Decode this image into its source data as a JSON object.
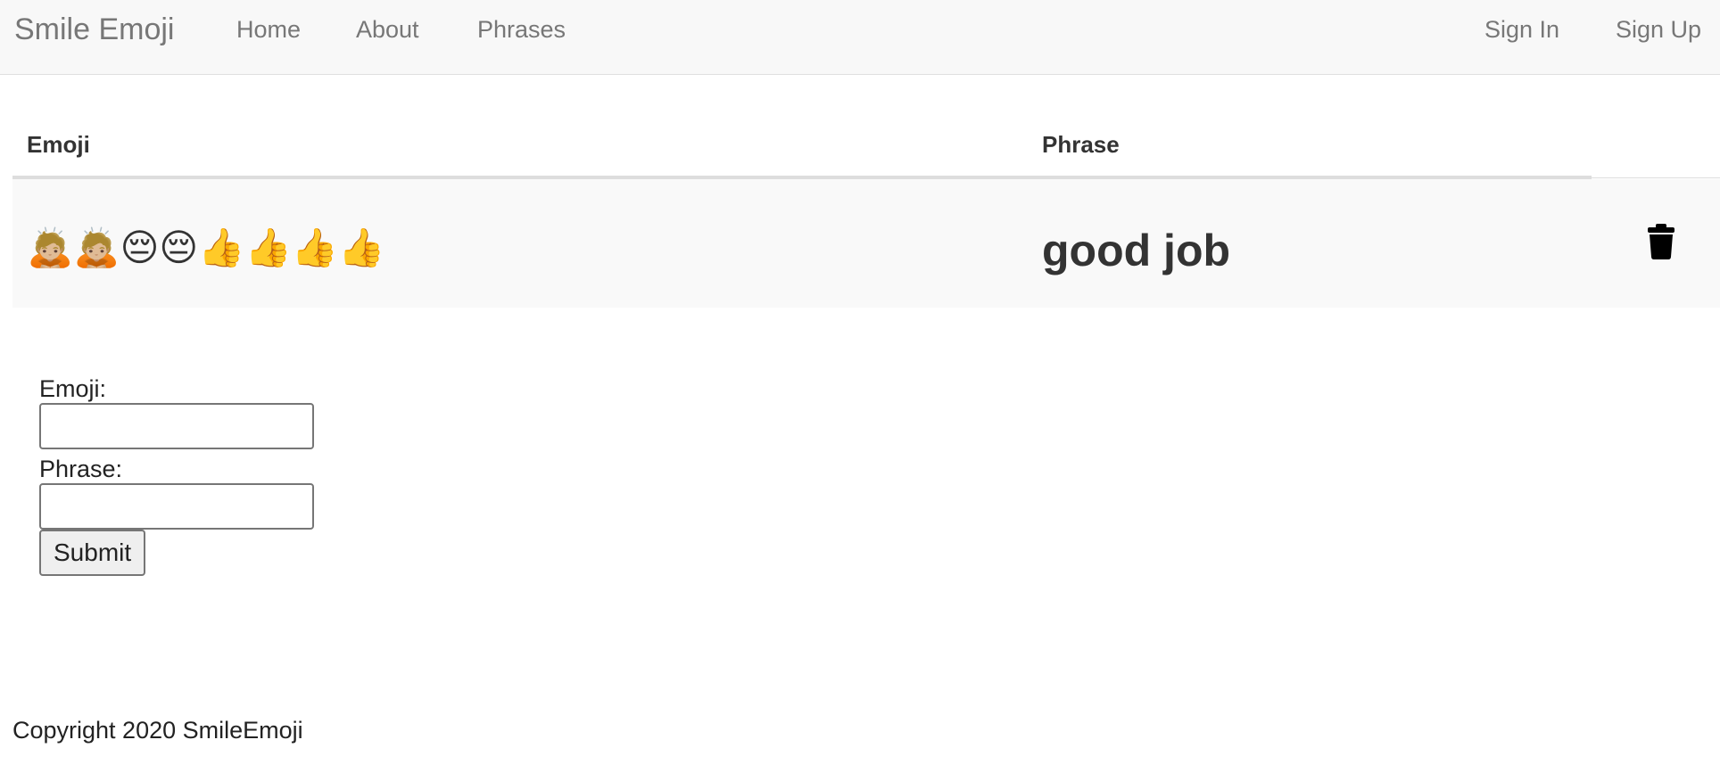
{
  "navbar": {
    "brand": "Smile Emoji",
    "links": [
      "Home",
      "About",
      "Phrases"
    ],
    "right_links": [
      "Sign In",
      "Sign Up"
    ]
  },
  "table": {
    "headers": [
      "Emoji",
      "Phrase"
    ],
    "rows": [
      {
        "emoji": "🙇🏼🙇🏼😔😔👍👍👍👍",
        "phrase": "good job",
        "action_icon": "trash-icon"
      }
    ]
  },
  "form": {
    "emoji_label": "Emoji:",
    "emoji_value": "",
    "phrase_label": "Phrase:",
    "phrase_value": "",
    "submit_label": "Submit"
  },
  "footer": {
    "copyright": "Copyright 2020 SmileEmoji"
  },
  "colors": {
    "navbar_bg": "#f8f8f8",
    "nav_text": "#777777",
    "row_bg": "#f9f9f9"
  }
}
